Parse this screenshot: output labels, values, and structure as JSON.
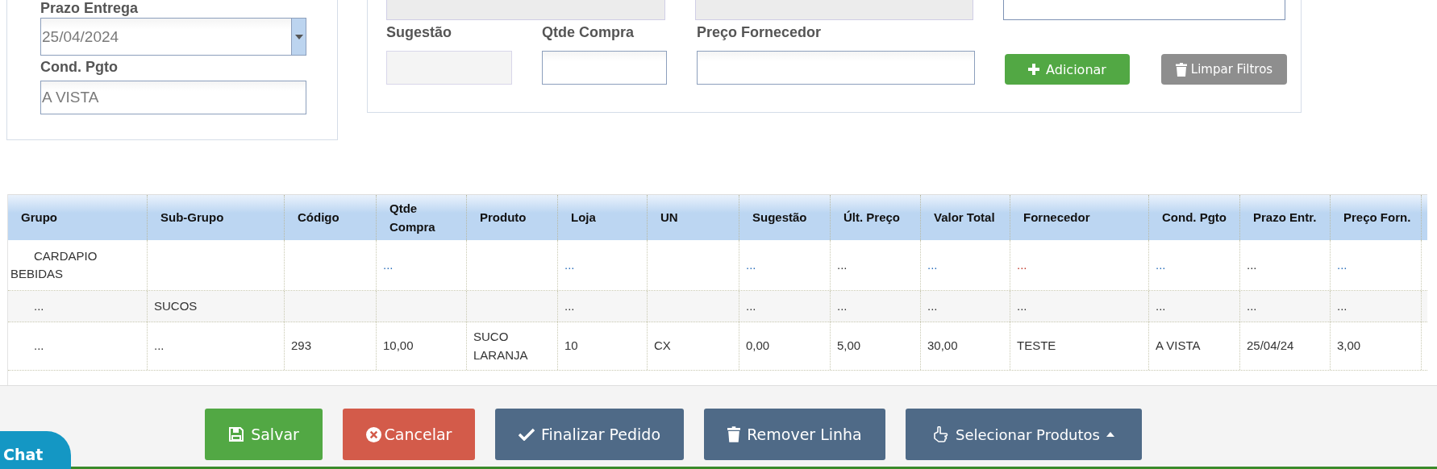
{
  "delivery": {
    "label": "Prazo Entrega",
    "value": "25/04/2024"
  },
  "payment": {
    "label": "Cond. Pgto",
    "value": "A VISTA"
  },
  "filters": {
    "top_fields": [
      {
        "disabled": true
      },
      {
        "disabled": true
      },
      {
        "disabled": false
      }
    ],
    "fields": [
      {
        "label": "Sugestão",
        "disabled": true
      },
      {
        "label": "Qtde Compra",
        "disabled": false
      },
      {
        "label": "Preço Fornecedor",
        "disabled": false
      }
    ],
    "buttons": [
      {
        "label": "Adicionar",
        "kind": "add"
      },
      {
        "label": "Limpar Filtros",
        "kind": "clear"
      }
    ]
  },
  "table": {
    "columns": [
      "Grupo",
      "Sub-Grupo",
      "Código",
      "Qtde Compra",
      "Produto",
      "Loja",
      "UN",
      "Sugestão",
      "Últ. Preço",
      "Valor Total",
      "Fornecedor",
      "Cond. Pgto",
      "Prazo Entr.",
      "Preço Forn."
    ],
    "rows": [
      {
        "cells": [
          {
            "text": "CARDAPIO BEBIDAS",
            "kind": "text"
          },
          null,
          null,
          {
            "text": "...",
            "kind": "link"
          },
          null,
          {
            "text": "...",
            "kind": "link"
          },
          null,
          {
            "text": "...",
            "kind": "link"
          },
          {
            "text": "...",
            "kind": "text"
          },
          {
            "text": "...",
            "kind": "link"
          },
          {
            "text": "...",
            "kind": "alert"
          },
          {
            "text": "...",
            "kind": "link"
          },
          {
            "text": "...",
            "kind": "text"
          },
          {
            "text": "...",
            "kind": "link"
          }
        ]
      },
      {
        "cells": [
          {
            "text": "...",
            "kind": "text"
          },
          {
            "text": "SUCOS",
            "kind": "text"
          },
          null,
          null,
          null,
          {
            "text": "...",
            "kind": "text"
          },
          null,
          {
            "text": "...",
            "kind": "text"
          },
          {
            "text": "...",
            "kind": "text"
          },
          {
            "text": "...",
            "kind": "text"
          },
          {
            "text": "...",
            "kind": "text"
          },
          {
            "text": "...",
            "kind": "text"
          },
          {
            "text": "...",
            "kind": "text"
          },
          {
            "text": "...",
            "kind": "text"
          }
        ]
      },
      {
        "cells": [
          {
            "text": "...",
            "kind": "text"
          },
          {
            "text": "...",
            "kind": "text"
          },
          {
            "text": "293",
            "kind": "text"
          },
          {
            "text": "10,00",
            "kind": "text"
          },
          {
            "text": "SUCO LARANJA",
            "kind": "text"
          },
          {
            "text": "10",
            "kind": "text"
          },
          {
            "text": "CX",
            "kind": "text"
          },
          {
            "text": "0,00",
            "kind": "text"
          },
          {
            "text": "5,00",
            "kind": "text"
          },
          {
            "text": "30,00",
            "kind": "text"
          },
          {
            "text": "TESTE",
            "kind": "text"
          },
          {
            "text": "A VISTA",
            "kind": "text"
          },
          {
            "text": "25/04/24",
            "kind": "text"
          },
          {
            "text": "3,00",
            "kind": "text"
          }
        ]
      }
    ]
  },
  "actions": [
    {
      "label": "Salvar",
      "kind": "save"
    },
    {
      "label": "Cancelar",
      "kind": "cancel"
    },
    {
      "label": "Finalizar Pedido",
      "kind": "finish"
    },
    {
      "label": "Remover Linha",
      "kind": "remove"
    },
    {
      "label": "Selecionar Produtos",
      "kind": "select"
    }
  ],
  "chat": {
    "label": "Chat"
  }
}
